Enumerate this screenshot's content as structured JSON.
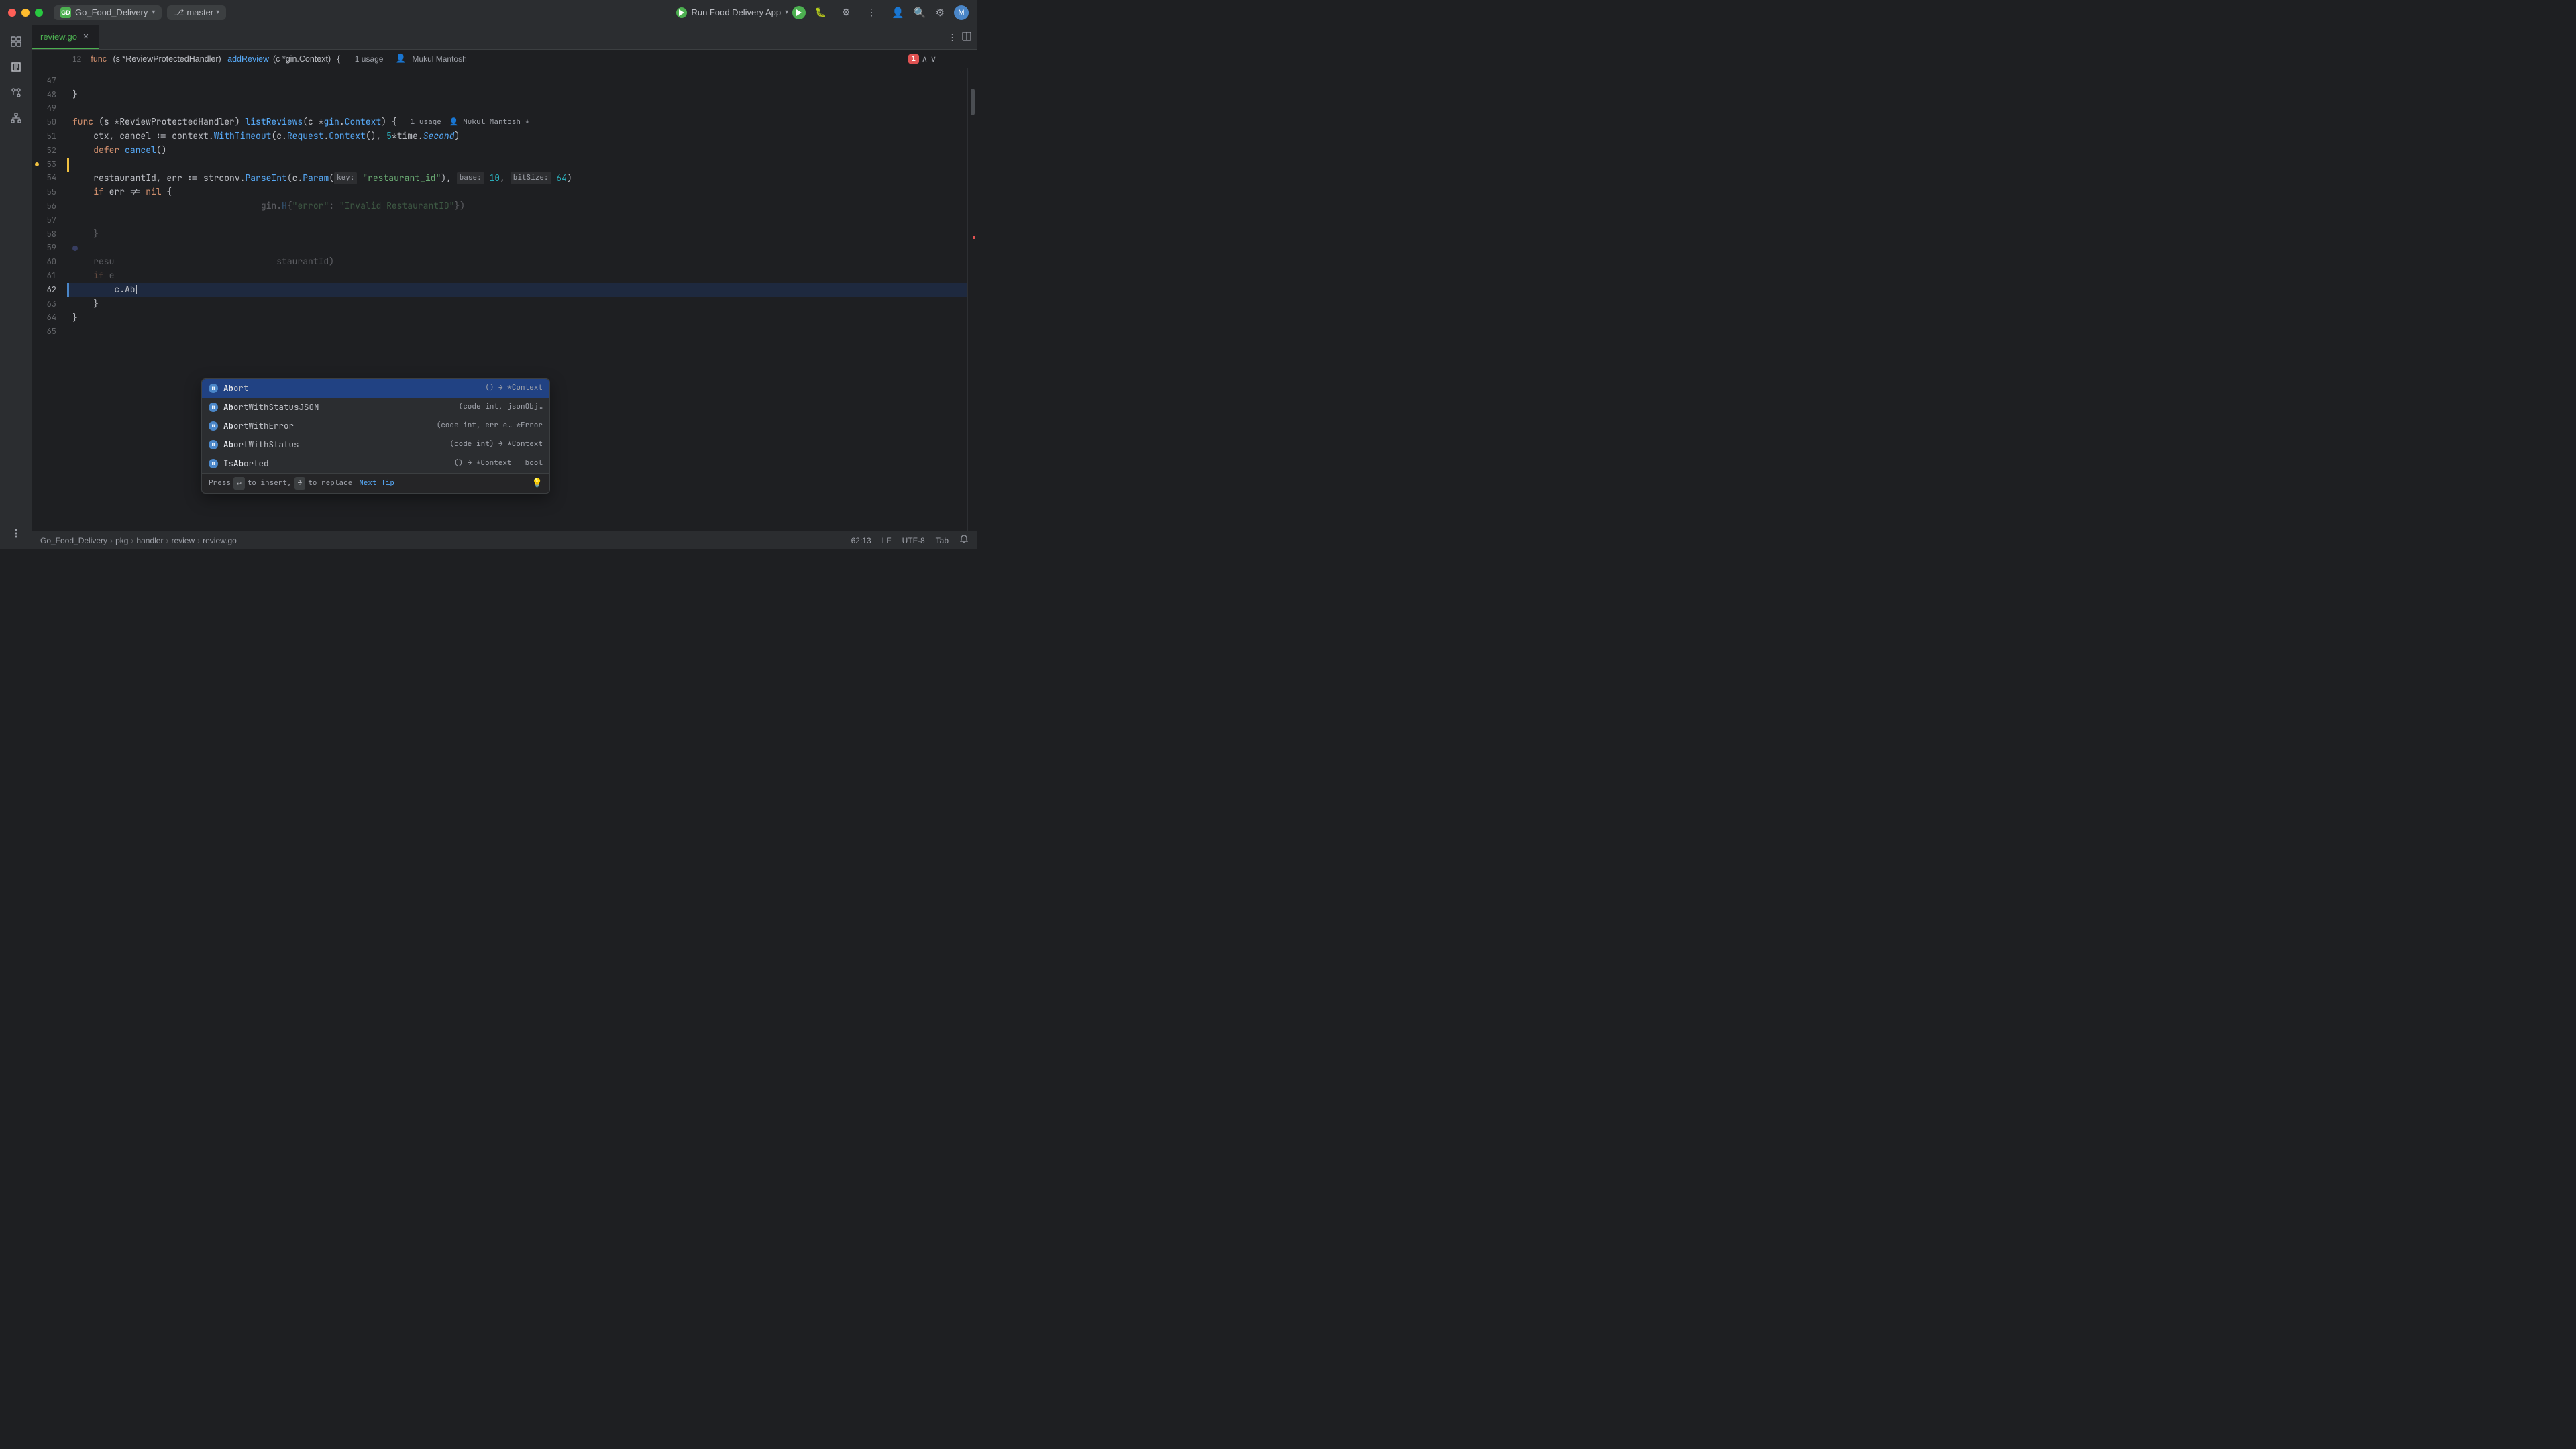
{
  "titlebar": {
    "traffic": [
      "close",
      "minimize",
      "maximize"
    ],
    "project": {
      "icon": "GD",
      "name": "Go_Food_Delivery",
      "chevron": "▾"
    },
    "branch": {
      "icon": "⎇",
      "name": "master",
      "chevron": "▾"
    },
    "run_config": {
      "label": "Run Food Delivery App",
      "chevron": "▾"
    },
    "icons": [
      "⚙",
      "⋮",
      "👤",
      "🔍",
      "⚙"
    ]
  },
  "tabs": [
    {
      "name": "review.go",
      "active": true,
      "color": "green"
    }
  ],
  "function_header": {
    "line": "12",
    "keyword": "func",
    "receiver": "(s *ReviewProtectedHandler)",
    "func_name": "addReview",
    "params": "(c *gin.Context)",
    "brace": "{",
    "usage": "1 usage",
    "author_icon": "👤",
    "author": "Mukul Mantosh",
    "error_count": "1"
  },
  "code": {
    "lines": [
      {
        "num": "12",
        "content": "func (s *ReviewProtectedHandler) addReview(c *gin.Context) {  1 usage   Mukul Mantosh",
        "type": "func-decl"
      },
      {
        "num": "47",
        "content": ""
      },
      {
        "num": "48",
        "content": "}"
      },
      {
        "num": "49",
        "content": ""
      },
      {
        "num": "50",
        "content": "func (s *ReviewProtectedHandler) listReviews(c *gin.Context) {  1 usage   Mukul Mantosh *",
        "type": "func-decl"
      },
      {
        "num": "51",
        "content": "    ctx, cancel := context.WithTimeout(c.Request.Context(), 5*time.Second)",
        "type": "normal"
      },
      {
        "num": "52",
        "content": "    defer cancel()",
        "type": "normal"
      },
      {
        "num": "53",
        "content": "",
        "type": "blank-gutter"
      },
      {
        "num": "54",
        "content": "    restaurantId, err := strconv.ParseInt(c.Param( key: \"restaurant_id\"),  base: 10,  bitSize: 64)",
        "type": "normal"
      },
      {
        "num": "55",
        "content": "    if err != nil {",
        "type": "normal"
      },
      {
        "num": "56",
        "content": "                                    gin.H{\"error\": \"Invalid RestaurantID\"})",
        "type": "autocomplete-visible"
      },
      {
        "num": "57",
        "content": "",
        "type": "autocomplete-visible"
      },
      {
        "num": "58",
        "content": "    }",
        "type": "autocomplete-visible"
      },
      {
        "num": "59",
        "content": "",
        "type": "autocomplete-visible"
      },
      {
        "num": "60",
        "content": "    resu                               staurantId)",
        "type": "autocomplete-visible"
      },
      {
        "num": "61",
        "content": "    if e",
        "type": "autocomplete-visible"
      },
      {
        "num": "62",
        "content": "        c.Ab",
        "type": "active",
        "cursor": true
      },
      {
        "num": "63",
        "content": "    }",
        "type": "normal"
      },
      {
        "num": "64",
        "content": "}",
        "type": "normal"
      },
      {
        "num": "65",
        "content": "",
        "type": "normal"
      }
    ]
  },
  "autocomplete": {
    "items": [
      {
        "id": 0,
        "name": "Abort",
        "signature": "() → *Context",
        "type": "",
        "selected": true
      },
      {
        "id": 1,
        "name": "AbortWithStatusJSON",
        "signature": "(code int, jsonObj…",
        "type": "",
        "selected": false
      },
      {
        "id": 2,
        "name": "AbortWithError",
        "signature": "(code int, err e… *Error",
        "type": "",
        "selected": false
      },
      {
        "id": 3,
        "name": "AbortWithStatus",
        "signature": "(code int) → *Context",
        "type": "",
        "selected": false
      },
      {
        "id": 4,
        "name": "IsAborted",
        "signature": "() → *Context",
        "type": "bool",
        "selected": false
      }
    ],
    "footer": {
      "enter_hint": "Press ↵ to insert,",
      "tab_hint": "→ to replace",
      "next_tip": "Next Tip"
    }
  },
  "status_bar": {
    "breadcrumb": [
      "Go_Food_Delivery",
      "pkg",
      "handler",
      "review",
      "review.go"
    ],
    "position": "62:13",
    "encoding": "LF",
    "charset": "UTF-8",
    "indent": "Tab",
    "notifications": ""
  }
}
